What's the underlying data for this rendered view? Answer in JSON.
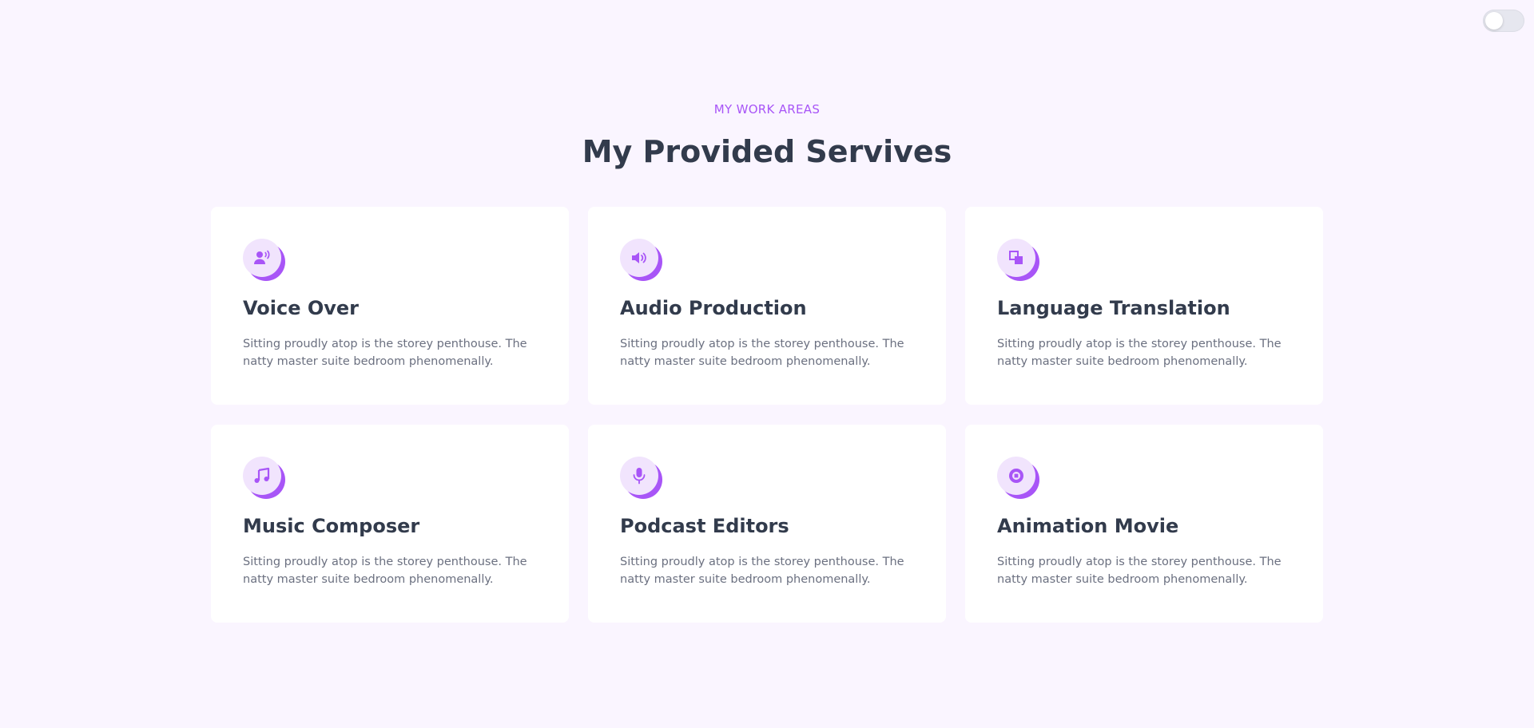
{
  "header": {
    "kicker": "MY WORK AREAS",
    "title": "My Provided Servives"
  },
  "theme_toggle": {
    "state": "off"
  },
  "colors": {
    "background": "#faf5ff",
    "accent": "#a855f7",
    "icon_bg": "#f1e4fd",
    "heading": "#323b4c",
    "body_text": "#6b7080",
    "card": "#ffffff"
  },
  "services": [
    {
      "icon": "voice-over-icon",
      "title": "Voice Over",
      "description": "Sitting proudly atop is the storey penthouse. The natty master suite bedroom phenomenally."
    },
    {
      "icon": "speaker-icon",
      "title": "Audio Production",
      "description": "Sitting proudly atop is the storey penthouse. The natty master suite bedroom phenomenally."
    },
    {
      "icon": "language-icon",
      "title": "Language Translation",
      "description": "Sitting proudly atop is the storey penthouse. The natty master suite bedroom phenomenally."
    },
    {
      "icon": "music-note-icon",
      "title": "Music Composer",
      "description": "Sitting proudly atop is the storey penthouse. The natty master suite bedroom phenomenally."
    },
    {
      "icon": "microphone-icon",
      "title": "Podcast Editors",
      "description": "Sitting proudly atop is the storey penthouse. The natty master suite bedroom phenomenally."
    },
    {
      "icon": "disc-icon",
      "title": "Animation Movie",
      "description": "Sitting proudly atop is the storey penthouse. The natty master suite bedroom phenomenally."
    }
  ]
}
